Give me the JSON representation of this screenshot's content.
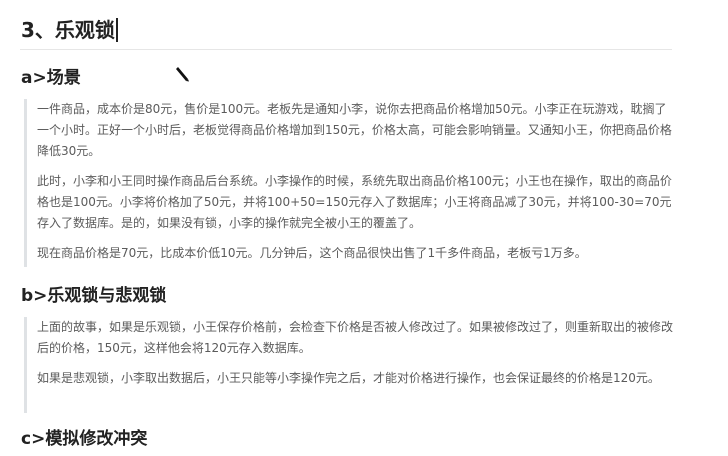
{
  "section_title": "3、乐观锁",
  "sections": [
    {
      "heading": "a>场景",
      "paragraphs": [
        "一件商品，成本价是80元，售价是100元。老板先是通知小李，说你去把商品价格增加50元。小李正在玩游戏，耽搁了一个小时。正好一个小时后，老板觉得商品价格增加到150元，价格太高，可能会影响销量。又通知小王，你把商品价格降低30元。",
        "此时，小李和小王同时操作商品后台系统。小李操作的时候，系统先取出商品价格100元；小王也在操作，取出的商品价格也是100元。小李将价格加了50元，并将100+50=150元存入了数据库；小王将商品减了30元，并将100-30=70元存入了数据库。是的，如果没有锁，小李的操作就完全被小王的覆盖了。",
        "现在商品价格是70元，比成本价低10元。几分钟后，这个商品很快出售了1千多件商品，老板亏1万多。"
      ]
    },
    {
      "heading": "b>乐观锁与悲观锁",
      "paragraphs": [
        "上面的故事，如果是乐观锁，小王保存价格前，会检查下价格是否被人修改过了。如果被修改过了，则重新取出的被修改后的价格，150元，这样他会将120元存入数据库。",
        "如果是悲观锁，小李取出数据后，小王只能等小李操作完之后，才能对价格进行操作，也会保证最终的价格是120元。"
      ]
    },
    {
      "heading": "c>模拟修改冲突",
      "paragraphs": []
    }
  ]
}
